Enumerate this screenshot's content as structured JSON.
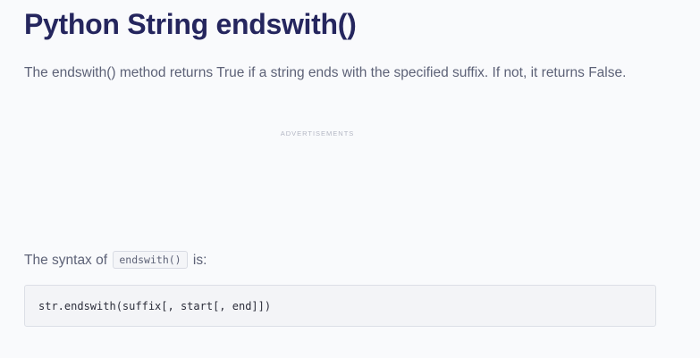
{
  "page": {
    "title": "Python String endswith()",
    "intro": "The endswith() method returns True if a string ends with the specified suffix. If not, it returns False.",
    "ads_label": "ADVERTISEMENTS",
    "syntax": {
      "prefix": "The syntax of",
      "inline_code": "endswith()",
      "suffix": "is:"
    },
    "code_block": "str.endswith(suffix[, start[, end]])"
  },
  "colors": {
    "title": "#25265e",
    "body_text": "#5d6277",
    "background": "#f9fafc",
    "code_bg": "#f3f4f7"
  }
}
